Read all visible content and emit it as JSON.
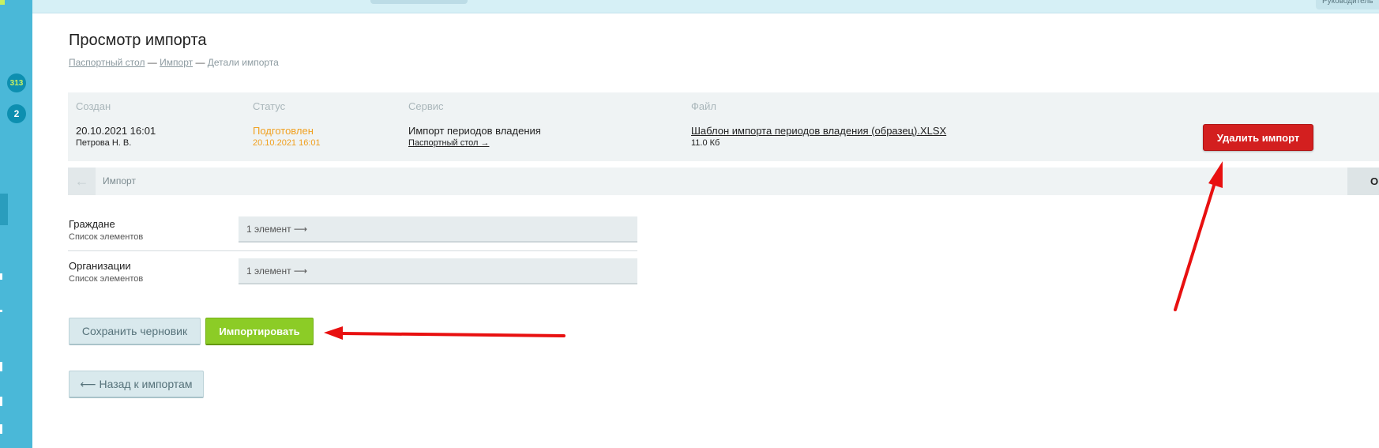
{
  "topbar": {
    "user_label": "Руководитель"
  },
  "sidebar": {
    "badges": [
      "313",
      "2"
    ]
  },
  "page": {
    "title": "Просмотр импорта",
    "breadcrumbs": [
      "Паспортный стол",
      "Импорт",
      "Детали импорта"
    ],
    "breadcrumb_sep": "—"
  },
  "info": {
    "created_label": "Создан",
    "created_date": "20.10.2021 16:01",
    "created_by": "Петрова Н. В.",
    "status_label": "Статус",
    "status_value": "Подготовлен",
    "status_date": "20.10.2021 16:01",
    "service_label": "Сервис",
    "service_value": "Импорт периодов владения",
    "service_link": "Паспортный стол →",
    "file_label": "Файл",
    "file_name": "Шаблон импорта периодов владения (образец).XLSX",
    "file_size": "11.0 Кб",
    "delete_button": "Удалить импорт"
  },
  "nav": {
    "back_icon": "←",
    "label": "Импорт",
    "right_text": "О"
  },
  "rows": [
    {
      "title": "Граждане",
      "subtitle": "Список элементов",
      "value": "1 элемент ⟶"
    },
    {
      "title": "Организации",
      "subtitle": "Список элементов",
      "value": "1 элемент ⟶"
    }
  ],
  "actions": {
    "save_draft": "Сохранить черновик",
    "import": "Импортировать",
    "back": "⟵ Назад к импортам"
  },
  "colors": {
    "sidebar": "#4ab8d8",
    "accent_red": "#d31f1f",
    "accent_green": "#8ccc26",
    "status_orange": "#f0a020",
    "annotation_arrow": "#e81010"
  }
}
